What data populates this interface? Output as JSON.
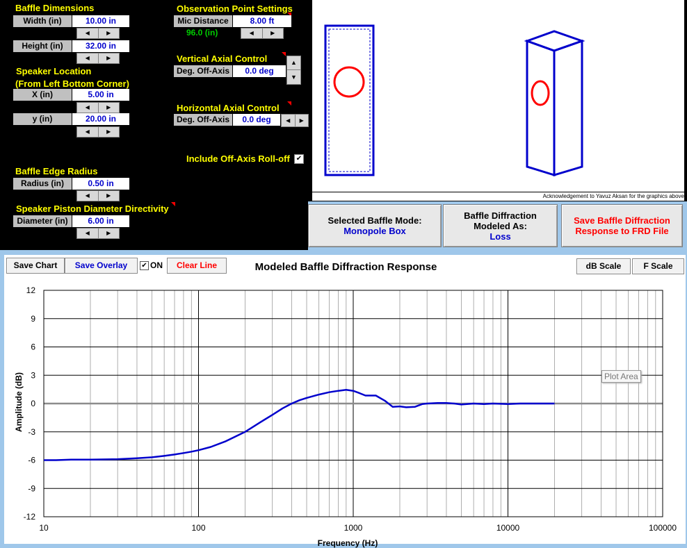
{
  "baffle": {
    "title": "Baffle Dimensions",
    "width_label": "Width (in)",
    "width_value": "10.00 in",
    "height_label": "Height (in)",
    "height_value": "32.00 in"
  },
  "speaker_location": {
    "title1": "Speaker Location",
    "title2": "(From Left Bottom Corner)",
    "x_label": "X (in)",
    "x_value": "5.00 in",
    "y_label": "y (in)",
    "y_value": "20.00 in"
  },
  "edge": {
    "title": "Baffle Edge Radius",
    "label": "Radius (in)",
    "value": "0.50 in"
  },
  "piston": {
    "title": "Speaker Piston Diameter Directivity",
    "label": "Diameter (in)",
    "value": "6.00 in"
  },
  "observation": {
    "title": "Observation Point Settings",
    "mic_label": "Mic Distance",
    "mic_value": "8.00 ft",
    "mic_inches": "96.0 (in)"
  },
  "vertical": {
    "title": "Vertical Axial Control",
    "label": "Deg. Off-Axis",
    "value": "0.0 deg"
  },
  "horizontal": {
    "title": "Horizontal Axial Control",
    "label": "Deg. Off-Axis",
    "value": "0.0 deg"
  },
  "rolloff": {
    "label": "Include Off-Axis Roll-off",
    "checked": true
  },
  "acknowledgement": "Acknowledgement to Yavuz Aksan for the graphics above",
  "mode_button": {
    "line1": "Selected Baffle Mode:",
    "line2": "Monopole Box"
  },
  "diffraction_button": {
    "line1": "Baffle Diffraction",
    "line2": "Modeled As:",
    "line3": "Loss"
  },
  "save_button": {
    "line1": "Save Baffle Diffraction",
    "line2": "Response to FRD File"
  },
  "toolbar": {
    "save_chart": "Save Chart",
    "save_overlay": "Save Overlay",
    "on_label": "ON",
    "clear_line": "Clear Line",
    "db_scale": "dB Scale",
    "f_scale": "F Scale"
  },
  "colors": {
    "curve": "#0000cc",
    "yellow": "#ffff00",
    "field_text": "#0000cc",
    "red": "#ff0000",
    "green": "#00cc00"
  },
  "chart_data": {
    "type": "line",
    "title": "Modeled Baffle Diffraction Response",
    "xlabel": "Frequency (Hz)",
    "ylabel": "Amplitude (dB)",
    "x_scale": "log",
    "xlim": [
      10,
      100000
    ],
    "ylim": [
      -12,
      12
    ],
    "x_ticks": [
      "10",
      "100",
      "1000",
      "10000",
      "100000"
    ],
    "y_ticks": [
      "12",
      "9",
      "6",
      "3",
      "0",
      "-3",
      "-6",
      "-9",
      "-12"
    ],
    "grid": true,
    "plot_area_label": "Plot Area",
    "series": [
      {
        "x": [
          10,
          12,
          15,
          20,
          30,
          40,
          50,
          60,
          70,
          80,
          90,
          100,
          120,
          150,
          200,
          250,
          300,
          350,
          400,
          450,
          500,
          600,
          700,
          800,
          900,
          1000,
          1100,
          1200,
          1400,
          1600,
          1800,
          2000,
          2200,
          2500,
          2800,
          3000,
          3500,
          4000,
          4500,
          5000,
          6000,
          7000,
          8000,
          10000,
          12000,
          15000,
          20000
        ],
        "y": [
          -6.0,
          -6.0,
          -5.95,
          -5.95,
          -5.9,
          -5.8,
          -5.7,
          -5.55,
          -5.4,
          -5.25,
          -5.1,
          -4.95,
          -4.6,
          -4.0,
          -3.0,
          -2.0,
          -1.2,
          -0.5,
          0.0,
          0.35,
          0.6,
          0.95,
          1.2,
          1.35,
          1.45,
          1.35,
          1.1,
          0.85,
          0.85,
          0.3,
          -0.35,
          -0.3,
          -0.4,
          -0.35,
          -0.05,
          0.0,
          0.05,
          0.05,
          0.0,
          -0.1,
          0.0,
          -0.05,
          0.0,
          -0.05,
          0.0,
          0.0,
          0.0
        ]
      }
    ]
  }
}
